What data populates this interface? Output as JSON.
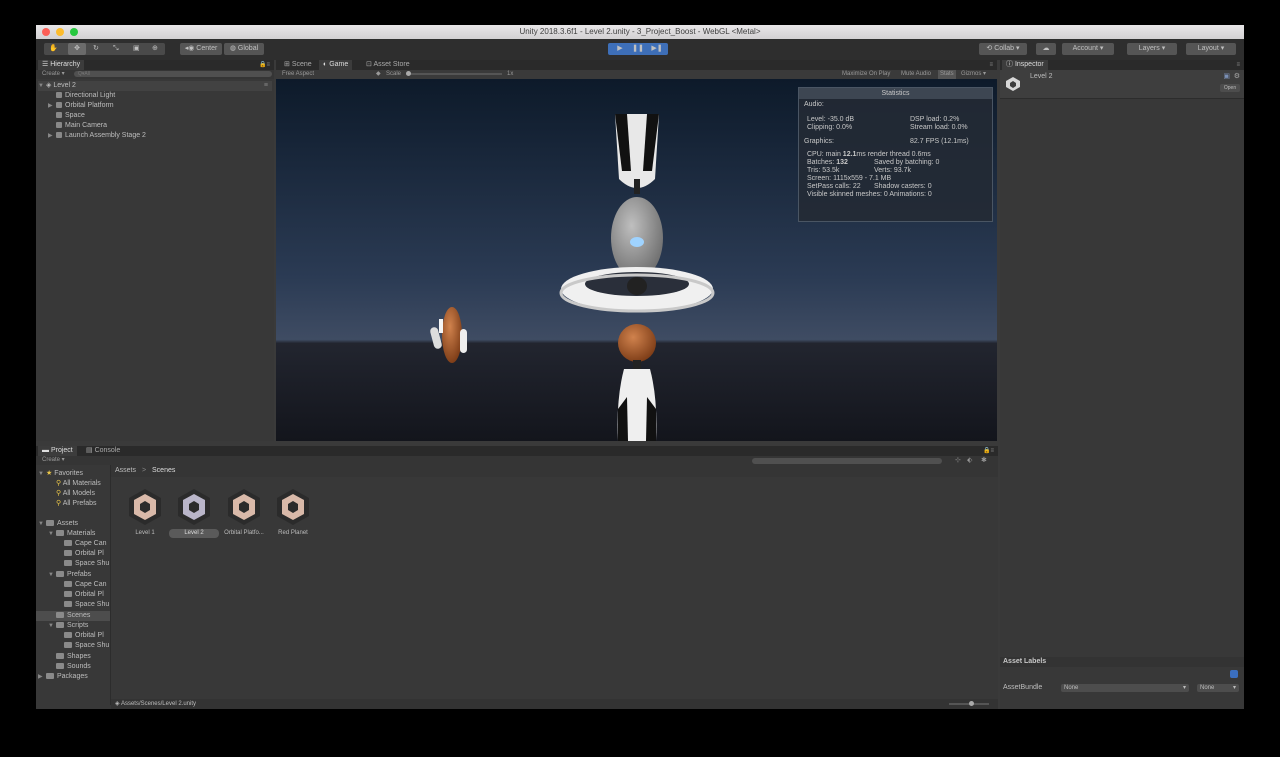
{
  "window_title": "Unity 2018.3.6f1 - Level 2.unity - 3_Project_Boost - WebGL <Metal>",
  "toolbar": {
    "center_label": "Center",
    "global_label": "Global",
    "collab_label": "Collab",
    "account_label": "Account",
    "layers_label": "Layers",
    "layout_label": "Layout"
  },
  "hierarchy": {
    "tab_label": "Hierarchy",
    "create_label": "Create",
    "search_placeholder": "Q▾All",
    "scene_name": "Level 2",
    "items": [
      "Directional Light",
      "Orbital Platform",
      "Space",
      "Main Camera",
      "Launch Assembly Stage 2"
    ]
  },
  "game_view": {
    "tabs": [
      "Scene",
      "Game",
      "Asset Store"
    ],
    "aspect_label": "Free Aspect",
    "scale_label": "Scale",
    "scale_value": "1x",
    "maximize_label": "Maximize On Play",
    "mute_label": "Mute Audio",
    "stats_label": "Stats",
    "gizmos_label": "Gizmos"
  },
  "statistics": {
    "title": "Statistics",
    "audio_header": "Audio:",
    "level": "Level: -35.0 dB",
    "clipping": "Clipping: 0.0%",
    "dsp_load": "DSP load: 0.2%",
    "stream_load": "Stream load: 0.0%",
    "graphics_header": "Graphics:",
    "fps": "82.7 FPS (12.1ms)",
    "cpu_prefix": "CPU: main ",
    "cpu_value": "12.1",
    "cpu_suffix": "ms  render thread 0.6ms",
    "batches_prefix": "Batches: ",
    "batches_value": "132",
    "saved_batching": "Saved by batching: 0",
    "tris": "Tris: 53.5k",
    "verts": "Verts: 93.7k",
    "screen": "Screen: 1115x559 - 7.1 MB",
    "setpass": "SetPass calls: 22",
    "shadow_casters": "Shadow casters: 0",
    "skinned": "Visible skinned meshes: 0  Animations: 0"
  },
  "inspector": {
    "tab_label": "Inspector",
    "object_name": "Level 2",
    "open_label": "Open",
    "asset_labels": "Asset Labels",
    "assetbundle_label": "AssetBundle",
    "bundle_value": "None",
    "variant_value": "None"
  },
  "project": {
    "tabs": [
      "Project",
      "Console"
    ],
    "create_label": "Create",
    "breadcrumb_root": "Assets",
    "breadcrumb_sep": ">",
    "breadcrumb_current": "Scenes",
    "favorites_label": "Favorites",
    "favorites": [
      "All Materials",
      "All Models",
      "All Prefabs"
    ],
    "assets_label": "Assets",
    "tree": [
      {
        "label": "Materials",
        "level": 1
      },
      {
        "label": "Cape Can",
        "level": 2
      },
      {
        "label": "Orbital Pl",
        "level": 2
      },
      {
        "label": "Space Shu",
        "level": 2
      },
      {
        "label": "Prefabs",
        "level": 1
      },
      {
        "label": "Cape Can",
        "level": 2
      },
      {
        "label": "Orbital Pl",
        "level": 2
      },
      {
        "label": "Space Shu",
        "level": 2
      },
      {
        "label": "Scenes",
        "level": 1
      },
      {
        "label": "Scripts",
        "level": 1
      },
      {
        "label": "Orbital Pl",
        "level": 2
      },
      {
        "label": "Space Shu",
        "level": 2
      },
      {
        "label": "Shapes",
        "level": 1
      },
      {
        "label": "Sounds",
        "level": 1
      }
    ],
    "packages_label": "Packages",
    "assets": [
      "Level 1",
      "Level 2",
      "Orbital Platfo...",
      "Red Planet"
    ],
    "selected_asset": "Level 2",
    "status_path": "Assets/Scenes/Level 2.unity"
  }
}
